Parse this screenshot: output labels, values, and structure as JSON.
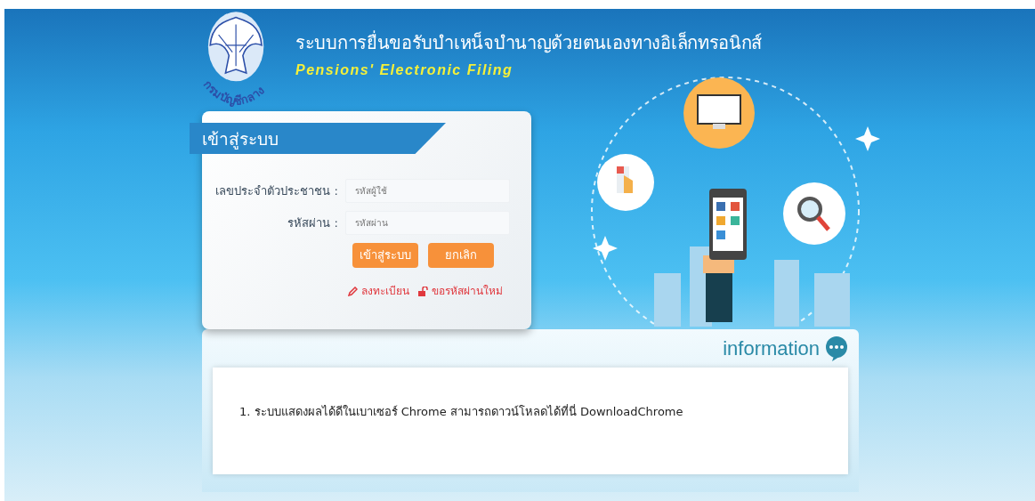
{
  "header": {
    "logo_text": "กรมบัญชีกลาง",
    "title": "ระบบการยื่นขอรับบำเหน็จบำนาญด้วยตนเองทางอิเล็กทรอนิกส์",
    "subtitle": "Pensions' Electronic Filing"
  },
  "login": {
    "heading": "เข้าสู่ระบบ",
    "fields": [
      {
        "label": "เลขประจำตัวประชาชน :",
        "placeholder": "รหัสผู้ใช้"
      },
      {
        "label": "รหัสผ่าน :",
        "placeholder": "รหัสผ่าน"
      }
    ],
    "buttons": [
      "เข้าสู่ระบบ",
      "ยกเลิก"
    ],
    "links": [
      {
        "kind": "register",
        "label": "ลงทะเบียน"
      },
      {
        "kind": "reset",
        "label": "ขอรหัสผ่านใหม่"
      }
    ]
  },
  "information": {
    "heading": "information",
    "items": [
      "1. ระบบแสดงผลได้ดีในเบาเซอร์ Chrome สามารถดาวน์โหลดได้ที่นี่ DownloadChrome"
    ]
  }
}
